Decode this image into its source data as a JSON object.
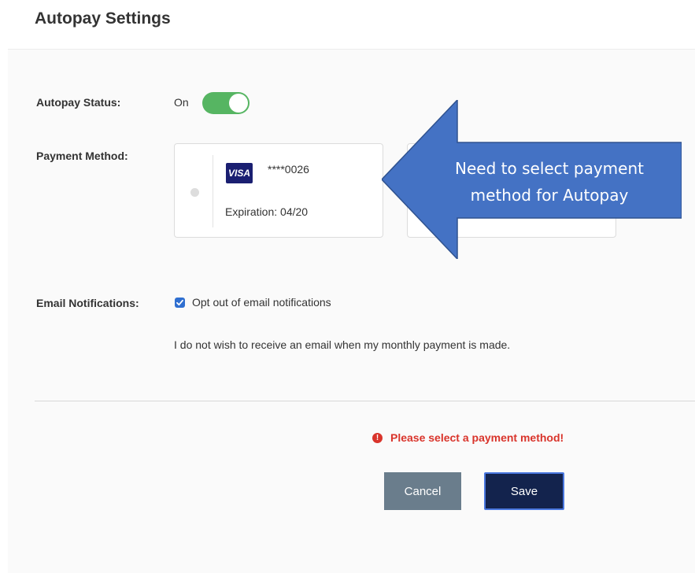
{
  "page": {
    "title": "Autopay Settings"
  },
  "autopay_status": {
    "label": "Autopay Status:",
    "value": "On",
    "enabled": true
  },
  "payment_method": {
    "label": "Payment Method:",
    "cards": [
      {
        "brand": "VISA",
        "number": "****0026",
        "expiration": "Expiration: 04/20",
        "selected": false
      }
    ]
  },
  "email_notifications": {
    "label": "Email Notifications:",
    "checkbox_label": "Opt out of email notifications",
    "checked": true,
    "description": "I do not wish to receive an email when my monthly payment is made."
  },
  "error": {
    "message": "Please select a payment method!",
    "icon": "alert-circle-icon",
    "color": "#d9342b"
  },
  "actions": {
    "cancel_label": "Cancel",
    "save_label": "Save"
  },
  "annotation": {
    "text": "Need to select payment method for Autopay",
    "color": "#4472c4"
  },
  "colors": {
    "toggle_on": "#56b562",
    "save_button": "#13234d",
    "cancel_button": "#6a7d8c",
    "checkbox": "#2f6fd0"
  }
}
